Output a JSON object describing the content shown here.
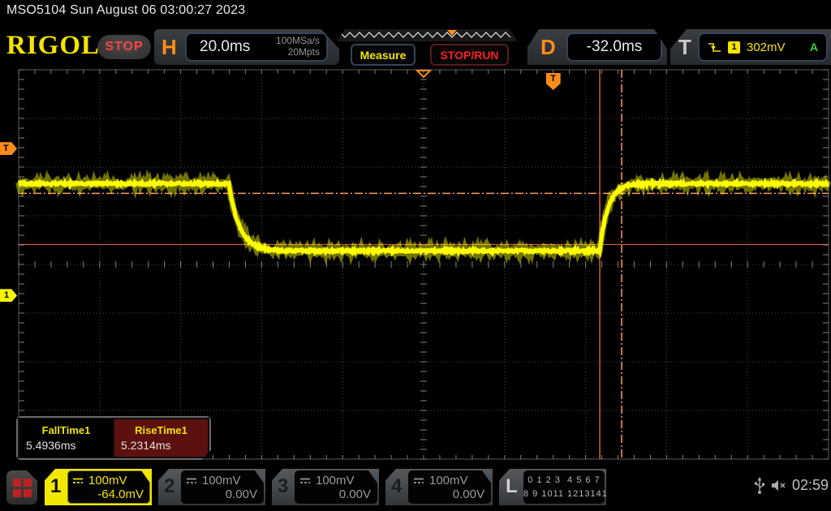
{
  "titlebar": {
    "text": "MSO5104  Sun August 06 03:00:27 2023"
  },
  "toolbar": {
    "brand": "RIGOL",
    "run_state": "STOP",
    "horizontal": {
      "label": "H",
      "scale": "20.0ms",
      "sample_rate": "100MSa/s",
      "memory_depth": "20Mpts"
    },
    "measure_label": "Measure",
    "stop_run_label": "STOP/RUN",
    "delay": {
      "label": "D",
      "value": "-32.0ms"
    },
    "trigger": {
      "label": "T",
      "source": "1",
      "level": "302mV",
      "sweep": "A"
    }
  },
  "measurements": [
    {
      "name": "FallTime1",
      "value": "5.4936ms"
    },
    {
      "name": "RiseTime1",
      "value": "5.2314ms"
    }
  ],
  "channels": [
    {
      "id": "1",
      "scale": "100mV",
      "offset": "-64.0mV"
    },
    {
      "id": "2",
      "scale": "100mV",
      "offset": "0.00V"
    },
    {
      "id": "3",
      "scale": "100mV",
      "offset": "0.00V"
    },
    {
      "id": "4",
      "scale": "100mV",
      "offset": "0.00V"
    }
  ],
  "logic": {
    "label": "L",
    "row1": "0 1 2 3  4 5 6 7",
    "row2": "8 9 1011 12131415"
  },
  "statusbar": {
    "time": "02:59"
  },
  "icons": {
    "trigger_slope": "falling-edge-icon",
    "coupling": "dc-coupling-icon",
    "usb": "usb-icon",
    "audio": "speaker-muted-icon",
    "menu": "menu-grid-icon"
  },
  "colors": {
    "accent_orange": "#ff8c1a",
    "waveform_yellow": "#ffff00",
    "cursor_solid": "#f07030",
    "cursor_dashdot": "#ff9a60",
    "grid": "#4a4a4a",
    "tick": "#808080",
    "frame": "#5a5a5a",
    "run_red": "#ff4343",
    "sweep_green": "#2fd32f"
  },
  "chart_data": {
    "type": "line",
    "title": "CH1 pulse with exponential (RC) edges",
    "x_units": "ms",
    "y_units": "mV",
    "timebase_ms_per_div": 20,
    "horizontal_divs": 10,
    "volts_per_div_mV": 100,
    "vertical_divs": 8,
    "delay_ms": -32,
    "ch1_offset_mV": -64,
    "trigger_level_mV": 302,
    "high_level_mV": 230,
    "low_level_mV": 92,
    "fall_start_ms": -80.1,
    "rise_start_ms": 11.5,
    "fall_tau_ms": 2.6,
    "rise_tau_ms": 2.0,
    "noise_mV": 5,
    "fall_time_ms": 5.4936,
    "rise_time_ms": 5.2314,
    "cursors": {
      "upper_threshold_mV": 210,
      "lower_threshold_mV": 105,
      "t1_ms": 11.5,
      "t2_ms": 16.9
    }
  }
}
